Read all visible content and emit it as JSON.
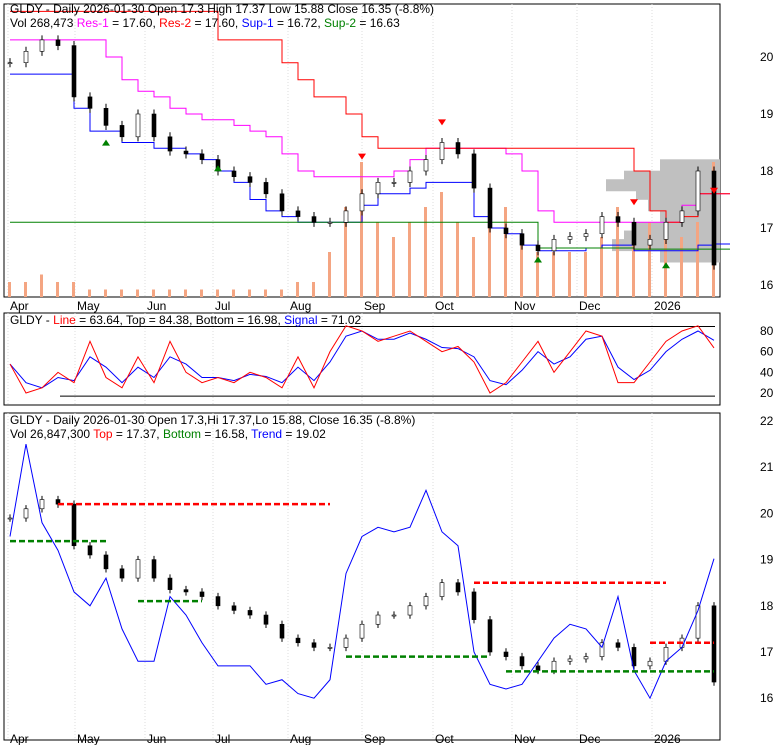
{
  "chart_data": [
    {
      "type": "candlestick",
      "panel": "price",
      "title": "GLDY - Daily 2026-01-30 Open 17.3  High 17.37  Low 15.88  Close 16.35 (-8.8%)",
      "vol_line": "Vol 268,473",
      "legend": [
        {
          "label": "Res-1",
          "value": "= 17.60,",
          "color": "#ff00ff"
        },
        {
          "label": "Res-2",
          "value": "= 17.60,",
          "color": "#ff0000"
        },
        {
          "label": "Sup-1",
          "value": "= 16.72,",
          "color": "#0000ff"
        },
        {
          "label": "Sup-2",
          "value": "= 16.63",
          "color": "#008000"
        }
      ],
      "yticks": [
        "20",
        "19",
        "18",
        "17",
        "16"
      ],
      "ylim": [
        15.85,
        20.75
      ],
      "xticks": [
        "Apr",
        "May",
        "Jun",
        "Jul",
        "Aug",
        "Sep",
        "Oct",
        "Nov",
        "Dec",
        "2026"
      ],
      "close": [
        19.9,
        20.1,
        20.3,
        20.2,
        19.3,
        19.1,
        18.8,
        18.6,
        19.0,
        18.6,
        18.35,
        18.3,
        18.2,
        18.0,
        17.9,
        17.8,
        17.6,
        17.3,
        17.2,
        17.1,
        17.1,
        17.3,
        17.6,
        17.8,
        17.8,
        18.0,
        18.2,
        18.5,
        18.3,
        17.7,
        17.0,
        16.9,
        16.7,
        16.6,
        16.8,
        16.85,
        16.9,
        17.2,
        17.1,
        16.7,
        16.8,
        17.1,
        17.3,
        18.0,
        16.35
      ],
      "volume": [
        0.1,
        0.1,
        0.15,
        0.1,
        0.1,
        0.05,
        0.05,
        0.05,
        0.05,
        0.05,
        0.05,
        0.05,
        0.05,
        0.05,
        0.05,
        0.05,
        0.05,
        0.05,
        0.1,
        0.1,
        0.3,
        0.6,
        0.9,
        0.5,
        0.4,
        0.5,
        0.6,
        0.7,
        0.5,
        0.4,
        0.5,
        0.6,
        0.4,
        0.3,
        0.3,
        0.3,
        0.3,
        0.4,
        0.6,
        0.5,
        0.5,
        0.4,
        0.4,
        0.5,
        0.9
      ],
      "res1": [
        20.3,
        20.3,
        20.3,
        20.3,
        20.3,
        20.3,
        20.0,
        19.6,
        19.4,
        19.3,
        19.1,
        19.0,
        18.9,
        18.9,
        18.8,
        18.7,
        18.6,
        18.3,
        18.0,
        17.9,
        17.9,
        17.9,
        17.9,
        17.9,
        18.0,
        18.2,
        18.4,
        18.4,
        18.4,
        18.4,
        18.4,
        18.3,
        18.0,
        17.3,
        17.1,
        17.1,
        17.1,
        17.1,
        17.1,
        17.1,
        17.1,
        17.1,
        17.4,
        17.6,
        17.6
      ],
      "res2": [
        20.8,
        20.8,
        20.8,
        20.8,
        20.8,
        20.8,
        20.8,
        20.8,
        20.8,
        20.8,
        20.8,
        20.8,
        20.8,
        20.3,
        20.3,
        20.3,
        20.3,
        19.9,
        19.6,
        19.3,
        19.3,
        19.0,
        18.6,
        18.4,
        18.4,
        18.4,
        18.4,
        18.4,
        18.4,
        18.4,
        18.4,
        18.4,
        18.4,
        18.4,
        18.4,
        18.4,
        18.4,
        18.4,
        18.4,
        18.0,
        17.3,
        17.1,
        17.2,
        17.6,
        17.6
      ],
      "sup1": [
        19.7,
        19.7,
        19.7,
        19.7,
        19.1,
        18.7,
        18.7,
        18.5,
        18.5,
        18.4,
        18.4,
        18.3,
        18.2,
        18.0,
        17.8,
        17.5,
        17.3,
        17.2,
        17.1,
        17.1,
        17.1,
        17.1,
        17.4,
        17.6,
        17.6,
        17.7,
        17.8,
        17.8,
        17.8,
        17.2,
        17.0,
        16.9,
        16.7,
        16.6,
        16.6,
        16.6,
        16.65,
        16.7,
        16.7,
        16.6,
        16.6,
        16.6,
        16.6,
        16.7,
        16.72
      ],
      "sup2": [
        17.1,
        17.1,
        17.1,
        17.1,
        17.1,
        17.1,
        17.1,
        17.1,
        17.1,
        17.1,
        17.1,
        17.1,
        17.1,
        17.1,
        17.1,
        17.1,
        17.1,
        17.1,
        17.1,
        17.1,
        17.1,
        17.1,
        17.1,
        17.1,
        17.1,
        17.1,
        17.1,
        17.1,
        17.1,
        17.1,
        17.1,
        17.1,
        17.1,
        16.65,
        16.65,
        16.65,
        16.65,
        16.65,
        16.65,
        16.63,
        16.63,
        16.63,
        16.63,
        16.63,
        16.63
      ]
    },
    {
      "type": "line",
      "panel": "oscillator",
      "title_prefix": "GLDY -",
      "legend": [
        {
          "label": "Line",
          "value": "= 63.64,",
          "color": "#ff0000"
        },
        {
          "label": "",
          "value": "Top = 84.38, Bottom = 16.98,",
          "color": "#000000"
        },
        {
          "label": "Signal",
          "value": "= 71.02",
          "color": "#0000ff"
        }
      ],
      "yticks": [
        "80",
        "60",
        "40",
        "20"
      ],
      "ylim": [
        10,
        90
      ],
      "line": [
        48,
        20,
        25,
        40,
        30,
        70,
        35,
        25,
        55,
        30,
        70,
        40,
        30,
        35,
        30,
        40,
        35,
        25,
        55,
        25,
        60,
        85,
        80,
        70,
        75,
        80,
        70,
        60,
        65,
        50,
        20,
        30,
        50,
        70,
        40,
        60,
        80,
        75,
        30,
        30,
        50,
        70,
        80,
        85,
        63.64
      ],
      "signal": [
        48,
        30,
        25,
        35,
        32,
        55,
        45,
        30,
        45,
        35,
        55,
        48,
        35,
        35,
        32,
        38,
        36,
        30,
        45,
        32,
        50,
        75,
        80,
        72,
        72,
        78,
        72,
        64,
        63,
        55,
        32,
        28,
        42,
        60,
        48,
        55,
        72,
        75,
        45,
        33,
        42,
        60,
        72,
        80,
        71.02
      ],
      "top": 84.38,
      "bottom": 16.98
    },
    {
      "type": "candlestick",
      "panel": "trend",
      "title": "GLDY - Daily 2026-01-30 Open 17.3,Hi 17.37,Lo 15.88, Close 16.35 (-8.8%)",
      "vol_line": "Vol 26,847,300",
      "legend": [
        {
          "label": "Top",
          "value": "= 17.37,",
          "color": "#ff0000"
        },
        {
          "label": "Bottom",
          "value": "= 16.58,",
          "color": "#008000"
        },
        {
          "label": "Trend",
          "value": "= 19.02",
          "color": "#0000ff"
        }
      ],
      "yticks": [
        "22",
        "21",
        "20",
        "19",
        "18",
        "17",
        "16"
      ],
      "ylim": [
        15.4,
        22.2
      ],
      "trend": [
        19.5,
        21.5,
        19.8,
        19.2,
        18.3,
        18.0,
        18.6,
        17.5,
        16.8,
        16.8,
        18.2,
        17.8,
        17.2,
        16.7,
        16.7,
        16.7,
        16.3,
        16.4,
        16.1,
        16.0,
        16.4,
        18.7,
        19.5,
        19.7,
        19.6,
        19.7,
        20.5,
        19.6,
        19.3,
        17.0,
        16.3,
        16.2,
        16.3,
        16.8,
        17.3,
        17.6,
        17.5,
        17.1,
        18.2,
        16.6,
        16.0,
        16.8,
        17.1,
        17.9,
        19.02
      ]
    }
  ]
}
